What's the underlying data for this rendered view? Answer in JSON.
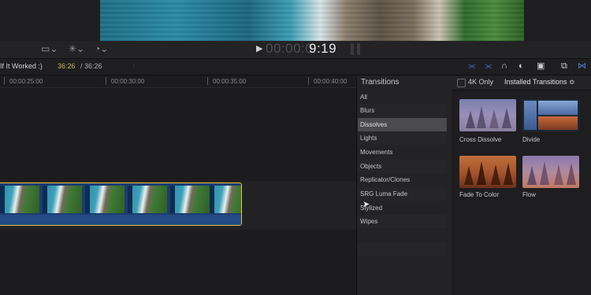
{
  "viewer": {
    "timecode_dim": "00:00:0",
    "timecode_main": "9:19"
  },
  "toolbar": {
    "icons": [
      "view-options-icon",
      "magic-wand-icon",
      "speed-icon",
      "play-icon"
    ]
  },
  "timeline_header": {
    "project_name": "If It Worked :)",
    "duration_current": "36:26",
    "duration_total": " / 36:26"
  },
  "ruler": {
    "ticks": [
      "00:00:25:00",
      "00:00:30:00",
      "00:00:35:00",
      "00:00:40:00"
    ]
  },
  "transitions": {
    "title": "Transitions",
    "categories": [
      {
        "label": "All",
        "selected": false
      },
      {
        "label": "Blurs",
        "selected": false
      },
      {
        "label": "Dissolves",
        "selected": true
      },
      {
        "label": "Lights",
        "selected": false
      },
      {
        "label": "Movements",
        "selected": false
      },
      {
        "label": "Objects",
        "selected": false
      },
      {
        "label": "Replicator/Clones",
        "selected": false
      },
      {
        "label": "SRG Luma Fade",
        "selected": false
      },
      {
        "label": "Stylized",
        "selected": false
      },
      {
        "label": "Wipes",
        "selected": false
      }
    ]
  },
  "browser": {
    "filter_4k_label": "4K Only",
    "filter_4k_checked": false,
    "installed_label": "Installed Transitions ≎",
    "items": [
      {
        "name": "Cross Dissolve"
      },
      {
        "name": "Divide"
      },
      {
        "name": "Fade To Color"
      },
      {
        "name": "Flow"
      }
    ]
  },
  "colors": {
    "accent_yellow": "#e6c440",
    "selection_gray": "#4a4a4f",
    "clip_blue": "#1c3d70",
    "icon_blue": "#4a7fd9"
  }
}
